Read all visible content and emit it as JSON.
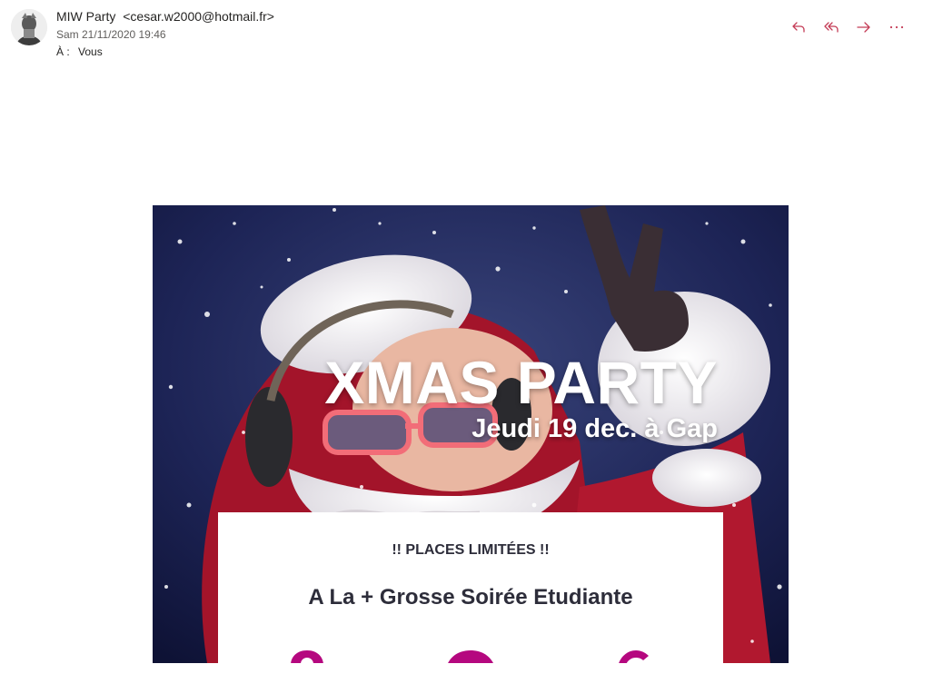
{
  "header": {
    "sender_name": "MIW Party",
    "sender_email": "<cesar.w2000@hotmail.fr>",
    "date": "Sam 21/11/2020 19:46",
    "to_label": "À :",
    "to_value": "Vous"
  },
  "actions": {
    "reply_icon": "reply-icon",
    "reply_all_icon": "reply-all-icon",
    "forward_icon": "forward-icon",
    "more_icon": "more-options-icon",
    "accent_color": "#c43c56"
  },
  "email_body": {
    "banner_title": "XMAS PARTY",
    "banner_subtitle": "Jeudi 19 dec. à Gap",
    "alert": "!! PLACES LIMITÉES !!",
    "headline": "A La + Grosse Soirée Etudiante",
    "feature_icons": [
      "location-icon",
      "play-icon",
      "euro-icon"
    ],
    "feature_icon_color": "#b5087f"
  }
}
